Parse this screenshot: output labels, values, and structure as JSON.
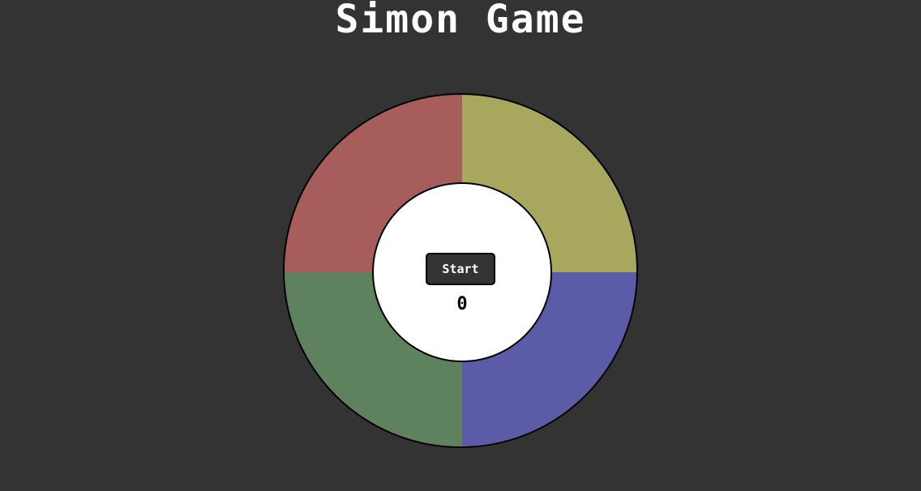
{
  "title": "Simon Game",
  "pads": [
    {
      "name": "red",
      "color": "#a85d5d"
    },
    {
      "name": "yellow",
      "color": "#a7a75d"
    },
    {
      "name": "green",
      "color": "#5d825d"
    },
    {
      "name": "blue",
      "color": "#5c5ba7"
    }
  ],
  "controls": {
    "start_label": "Start",
    "score": "0"
  },
  "colors": {
    "background": "#333333",
    "center": "#ffffff",
    "outline": "#000000"
  }
}
